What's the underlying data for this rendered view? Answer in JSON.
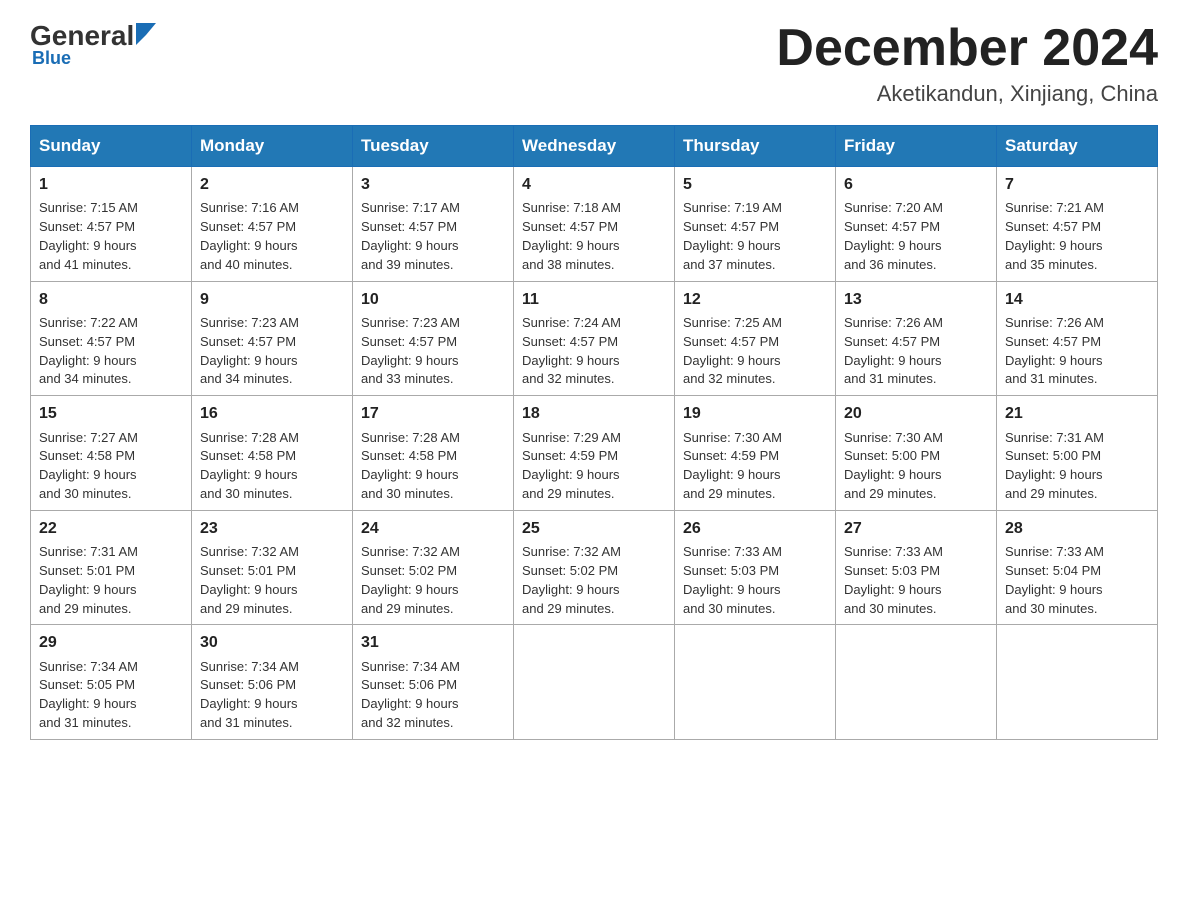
{
  "header": {
    "logo_general": "General",
    "logo_blue": "Blue",
    "month_title": "December 2024",
    "location": "Aketikandun, Xinjiang, China"
  },
  "days_of_week": [
    "Sunday",
    "Monday",
    "Tuesday",
    "Wednesday",
    "Thursday",
    "Friday",
    "Saturday"
  ],
  "weeks": [
    [
      {
        "day": "1",
        "sunrise": "7:15 AM",
        "sunset": "4:57 PM",
        "daylight": "9 hours and 41 minutes."
      },
      {
        "day": "2",
        "sunrise": "7:16 AM",
        "sunset": "4:57 PM",
        "daylight": "9 hours and 40 minutes."
      },
      {
        "day": "3",
        "sunrise": "7:17 AM",
        "sunset": "4:57 PM",
        "daylight": "9 hours and 39 minutes."
      },
      {
        "day": "4",
        "sunrise": "7:18 AM",
        "sunset": "4:57 PM",
        "daylight": "9 hours and 38 minutes."
      },
      {
        "day": "5",
        "sunrise": "7:19 AM",
        "sunset": "4:57 PM",
        "daylight": "9 hours and 37 minutes."
      },
      {
        "day": "6",
        "sunrise": "7:20 AM",
        "sunset": "4:57 PM",
        "daylight": "9 hours and 36 minutes."
      },
      {
        "day": "7",
        "sunrise": "7:21 AM",
        "sunset": "4:57 PM",
        "daylight": "9 hours and 35 minutes."
      }
    ],
    [
      {
        "day": "8",
        "sunrise": "7:22 AM",
        "sunset": "4:57 PM",
        "daylight": "9 hours and 34 minutes."
      },
      {
        "day": "9",
        "sunrise": "7:23 AM",
        "sunset": "4:57 PM",
        "daylight": "9 hours and 34 minutes."
      },
      {
        "day": "10",
        "sunrise": "7:23 AM",
        "sunset": "4:57 PM",
        "daylight": "9 hours and 33 minutes."
      },
      {
        "day": "11",
        "sunrise": "7:24 AM",
        "sunset": "4:57 PM",
        "daylight": "9 hours and 32 minutes."
      },
      {
        "day": "12",
        "sunrise": "7:25 AM",
        "sunset": "4:57 PM",
        "daylight": "9 hours and 32 minutes."
      },
      {
        "day": "13",
        "sunrise": "7:26 AM",
        "sunset": "4:57 PM",
        "daylight": "9 hours and 31 minutes."
      },
      {
        "day": "14",
        "sunrise": "7:26 AM",
        "sunset": "4:57 PM",
        "daylight": "9 hours and 31 minutes."
      }
    ],
    [
      {
        "day": "15",
        "sunrise": "7:27 AM",
        "sunset": "4:58 PM",
        "daylight": "9 hours and 30 minutes."
      },
      {
        "day": "16",
        "sunrise": "7:28 AM",
        "sunset": "4:58 PM",
        "daylight": "9 hours and 30 minutes."
      },
      {
        "day": "17",
        "sunrise": "7:28 AM",
        "sunset": "4:58 PM",
        "daylight": "9 hours and 30 minutes."
      },
      {
        "day": "18",
        "sunrise": "7:29 AM",
        "sunset": "4:59 PM",
        "daylight": "9 hours and 29 minutes."
      },
      {
        "day": "19",
        "sunrise": "7:30 AM",
        "sunset": "4:59 PM",
        "daylight": "9 hours and 29 minutes."
      },
      {
        "day": "20",
        "sunrise": "7:30 AM",
        "sunset": "5:00 PM",
        "daylight": "9 hours and 29 minutes."
      },
      {
        "day": "21",
        "sunrise": "7:31 AM",
        "sunset": "5:00 PM",
        "daylight": "9 hours and 29 minutes."
      }
    ],
    [
      {
        "day": "22",
        "sunrise": "7:31 AM",
        "sunset": "5:01 PM",
        "daylight": "9 hours and 29 minutes."
      },
      {
        "day": "23",
        "sunrise": "7:32 AM",
        "sunset": "5:01 PM",
        "daylight": "9 hours and 29 minutes."
      },
      {
        "day": "24",
        "sunrise": "7:32 AM",
        "sunset": "5:02 PM",
        "daylight": "9 hours and 29 minutes."
      },
      {
        "day": "25",
        "sunrise": "7:32 AM",
        "sunset": "5:02 PM",
        "daylight": "9 hours and 29 minutes."
      },
      {
        "day": "26",
        "sunrise": "7:33 AM",
        "sunset": "5:03 PM",
        "daylight": "9 hours and 30 minutes."
      },
      {
        "day": "27",
        "sunrise": "7:33 AM",
        "sunset": "5:03 PM",
        "daylight": "9 hours and 30 minutes."
      },
      {
        "day": "28",
        "sunrise": "7:33 AM",
        "sunset": "5:04 PM",
        "daylight": "9 hours and 30 minutes."
      }
    ],
    [
      {
        "day": "29",
        "sunrise": "7:34 AM",
        "sunset": "5:05 PM",
        "daylight": "9 hours and 31 minutes."
      },
      {
        "day": "30",
        "sunrise": "7:34 AM",
        "sunset": "5:06 PM",
        "daylight": "9 hours and 31 minutes."
      },
      {
        "day": "31",
        "sunrise": "7:34 AM",
        "sunset": "5:06 PM",
        "daylight": "9 hours and 32 minutes."
      },
      null,
      null,
      null,
      null
    ]
  ],
  "labels": {
    "sunrise": "Sunrise:",
    "sunset": "Sunset:",
    "daylight": "Daylight:"
  }
}
